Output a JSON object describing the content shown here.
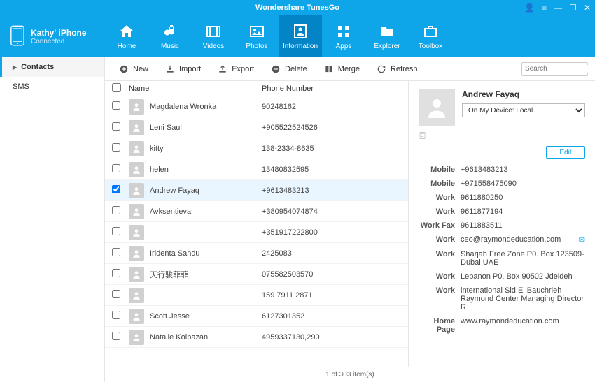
{
  "title": "Wondershare TunesGo",
  "device": {
    "name": "Kathy' iPhone",
    "status": "Connected"
  },
  "tabs": [
    {
      "label": "Home"
    },
    {
      "label": "Music"
    },
    {
      "label": "Videos"
    },
    {
      "label": "Photos"
    },
    {
      "label": "Information"
    },
    {
      "label": "Apps"
    },
    {
      "label": "Explorer"
    },
    {
      "label": "Toolbox"
    }
  ],
  "sidebar": {
    "contacts": "Contacts",
    "sms": "SMS"
  },
  "toolbar": {
    "new": "New",
    "import": "Import",
    "export": "Export",
    "delete": "Delete",
    "merge": "Merge",
    "refresh": "Refresh",
    "search_ph": "Search"
  },
  "columns": {
    "name": "Name",
    "phone": "Phone Number"
  },
  "contacts": [
    {
      "name": "Magdalena  Wronka",
      "phone": "90248162",
      "sel": false
    },
    {
      "name": "Leni  Saul",
      "phone": "+905522524526",
      "sel": false
    },
    {
      "name": "kitty",
      "phone": "138-2334-8635",
      "sel": false
    },
    {
      "name": "helen",
      "phone": "13480832595",
      "sel": false
    },
    {
      "name": "Andrew  Fayaq",
      "phone": "+9613483213",
      "sel": true
    },
    {
      "name": "Avksentieva",
      "phone": "+380954074874",
      "sel": false
    },
    {
      "name": "",
      "phone": "+351917222800",
      "sel": false
    },
    {
      "name": "Iridenta  Sandu",
      "phone": "2425083",
      "sel": false
    },
    {
      "name": "天行骏菲菲",
      "phone": "075582503570",
      "sel": false
    },
    {
      "name": "",
      "phone": "159 7911 2871",
      "sel": false
    },
    {
      "name": "Scott Jesse",
      "phone": "6127301352",
      "sel": false
    },
    {
      "name": "Natalie  Kolbazan",
      "phone": "4959337130,290",
      "sel": false
    }
  ],
  "detail": {
    "name": "Andrew  Fayaq",
    "location": "On My Device: Local",
    "edit": "Edit",
    "fields": [
      {
        "label": "Mobile",
        "value": "+9613483213"
      },
      {
        "label": "Mobile",
        "value": "+971558475090"
      },
      {
        "label": "Work",
        "value": "9611880250"
      },
      {
        "label": "Work",
        "value": "9611877194"
      },
      {
        "label": "Work Fax",
        "value": "9611883511"
      },
      {
        "label": "Work",
        "value": "ceo@raymondeducation.com",
        "mail": true
      },
      {
        "label": "Work",
        "value": "Sharjah Free Zone P0. Box 123509-Dubai UAE"
      },
      {
        "label": "Work",
        "value": "Lebanon P0. Box 90502 Jdeideh"
      },
      {
        "label": "Work",
        "value": "international Sid El Bauchrieh Raymond Center  Managing Director R"
      },
      {
        "label": "Home Page",
        "value": "www.raymondeducation.com"
      }
    ]
  },
  "status": "1  of  303  item(s)"
}
